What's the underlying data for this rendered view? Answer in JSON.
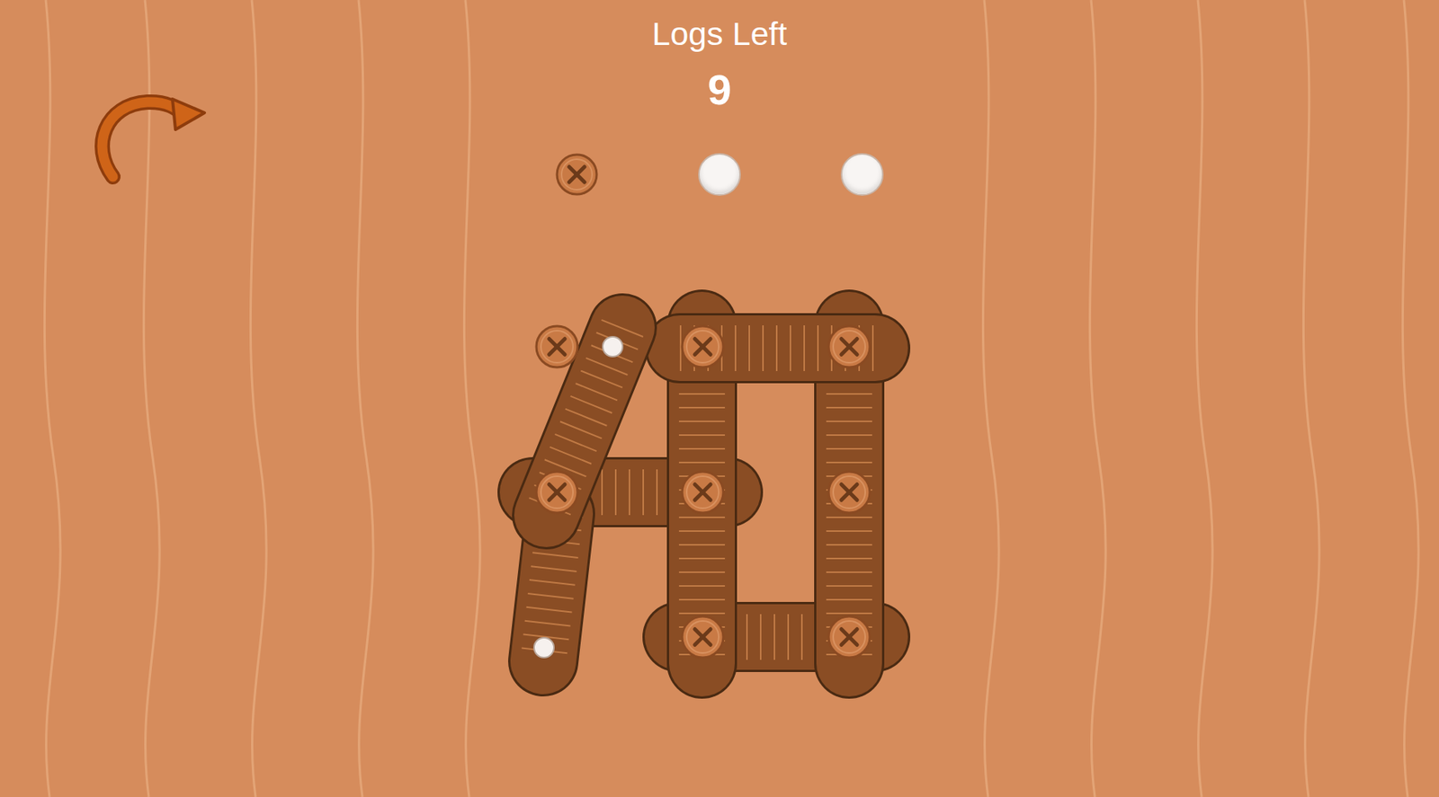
{
  "header": {
    "title": "Logs Left",
    "count": "9"
  },
  "tray": [
    {
      "kind": "screw",
      "filled": true
    },
    {
      "kind": "hole",
      "filled": false
    },
    {
      "kind": "hole",
      "filled": false
    }
  ]
}
